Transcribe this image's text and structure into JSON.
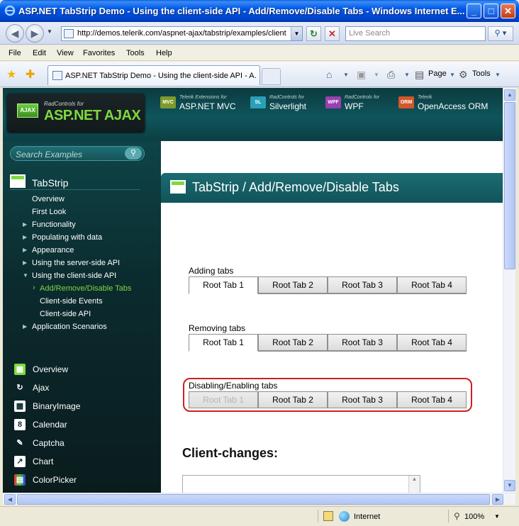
{
  "window": {
    "title": "ASP.NET TabStrip Demo - Using the client-side API - Add/Remove/Disable Tabs - Windows Internet E...",
    "minimize": "_",
    "maximize": "□",
    "close": "✕"
  },
  "address": {
    "url": "http://demos.telerik.com/aspnet-ajax/tabstrip/examples/client",
    "search_placeholder": "Live Search"
  },
  "menu": [
    "File",
    "Edit",
    "View",
    "Favorites",
    "Tools",
    "Help"
  ],
  "tab": {
    "title": "ASP.NET TabStrip Demo - Using the client-side API - A..."
  },
  "commands": {
    "page": "Page",
    "tools": "Tools"
  },
  "header": {
    "logo_small": "RadControls for",
    "logo_big": "ASP.NET AJAX",
    "logo_badge": "AJAX",
    "products": [
      {
        "badge": "MVC",
        "small": "Telerik Extensions for",
        "big": "ASP.NET MVC",
        "color": "#7e9a2c"
      },
      {
        "badge": "SL",
        "small": "RadControls for",
        "big": "Silverlight",
        "color": "#2a9fb8"
      },
      {
        "badge": "WPF",
        "small": "RadControls for",
        "big": "WPF",
        "color": "#9a3fb0"
      },
      {
        "badge": "ORM",
        "small": "Telerik",
        "big": "OpenAccess ORM",
        "color": "#d4572a"
      }
    ]
  },
  "sidebar": {
    "search_placeholder": "Search Examples",
    "section_title": "TabStrip",
    "nav": [
      {
        "label": "Overview",
        "arrow": ""
      },
      {
        "label": "First Look",
        "arrow": ""
      },
      {
        "label": "Functionality",
        "arrow": "▶"
      },
      {
        "label": "Populating with data",
        "arrow": "▶"
      },
      {
        "label": "Appearance",
        "arrow": "▶"
      },
      {
        "label": "Using the server-side API",
        "arrow": "▶"
      },
      {
        "label": "Using the client-side API",
        "arrow": "▼"
      },
      {
        "label": "Add/Remove/Disable Tabs",
        "arrow": "›"
      },
      {
        "label": "Client-side Events",
        "arrow": ""
      },
      {
        "label": "Client-side API",
        "arrow": ""
      },
      {
        "label": "Application Scenarios",
        "arrow": "▶"
      }
    ],
    "products": [
      {
        "label": "Overview",
        "icon": "overview-icon",
        "glyph": "▦"
      },
      {
        "label": "Ajax",
        "icon": "ajax-icon",
        "glyph": "↻"
      },
      {
        "label": "BinaryImage",
        "icon": "binaryimage-icon",
        "glyph": "▩"
      },
      {
        "label": "Calendar",
        "icon": "calendar-icon",
        "glyph": "8"
      },
      {
        "label": "Captcha",
        "icon": "captcha-icon",
        "glyph": "✎"
      },
      {
        "label": "Chart",
        "icon": "chart-icon",
        "glyph": "↗"
      },
      {
        "label": "ColorPicker",
        "icon": "colorpicker-icon",
        "glyph": "▤"
      }
    ]
  },
  "content": {
    "title": "TabStrip / Add/Remove/Disable Tabs",
    "sections": [
      {
        "label": "Adding tabs",
        "tabs": [
          "Root Tab 1",
          "Root Tab 2",
          "Root Tab 3",
          "Root Tab 4"
        ],
        "selected": 0,
        "disabled": -1
      },
      {
        "label": "Removing tabs",
        "tabs": [
          "Root Tab 1",
          "Root Tab 2",
          "Root Tab 3",
          "Root Tab 4"
        ],
        "selected": 0,
        "disabled": -1
      },
      {
        "label": "Disabling/Enabling tabs",
        "tabs": [
          "Root Tab 1",
          "Root Tab 2",
          "Root Tab 3",
          "Root Tab 4"
        ],
        "selected": -1,
        "disabled": 0
      }
    ],
    "client_changes_title": "Client-changes:"
  },
  "status": {
    "zone": "Internet",
    "zoom": "100%"
  }
}
